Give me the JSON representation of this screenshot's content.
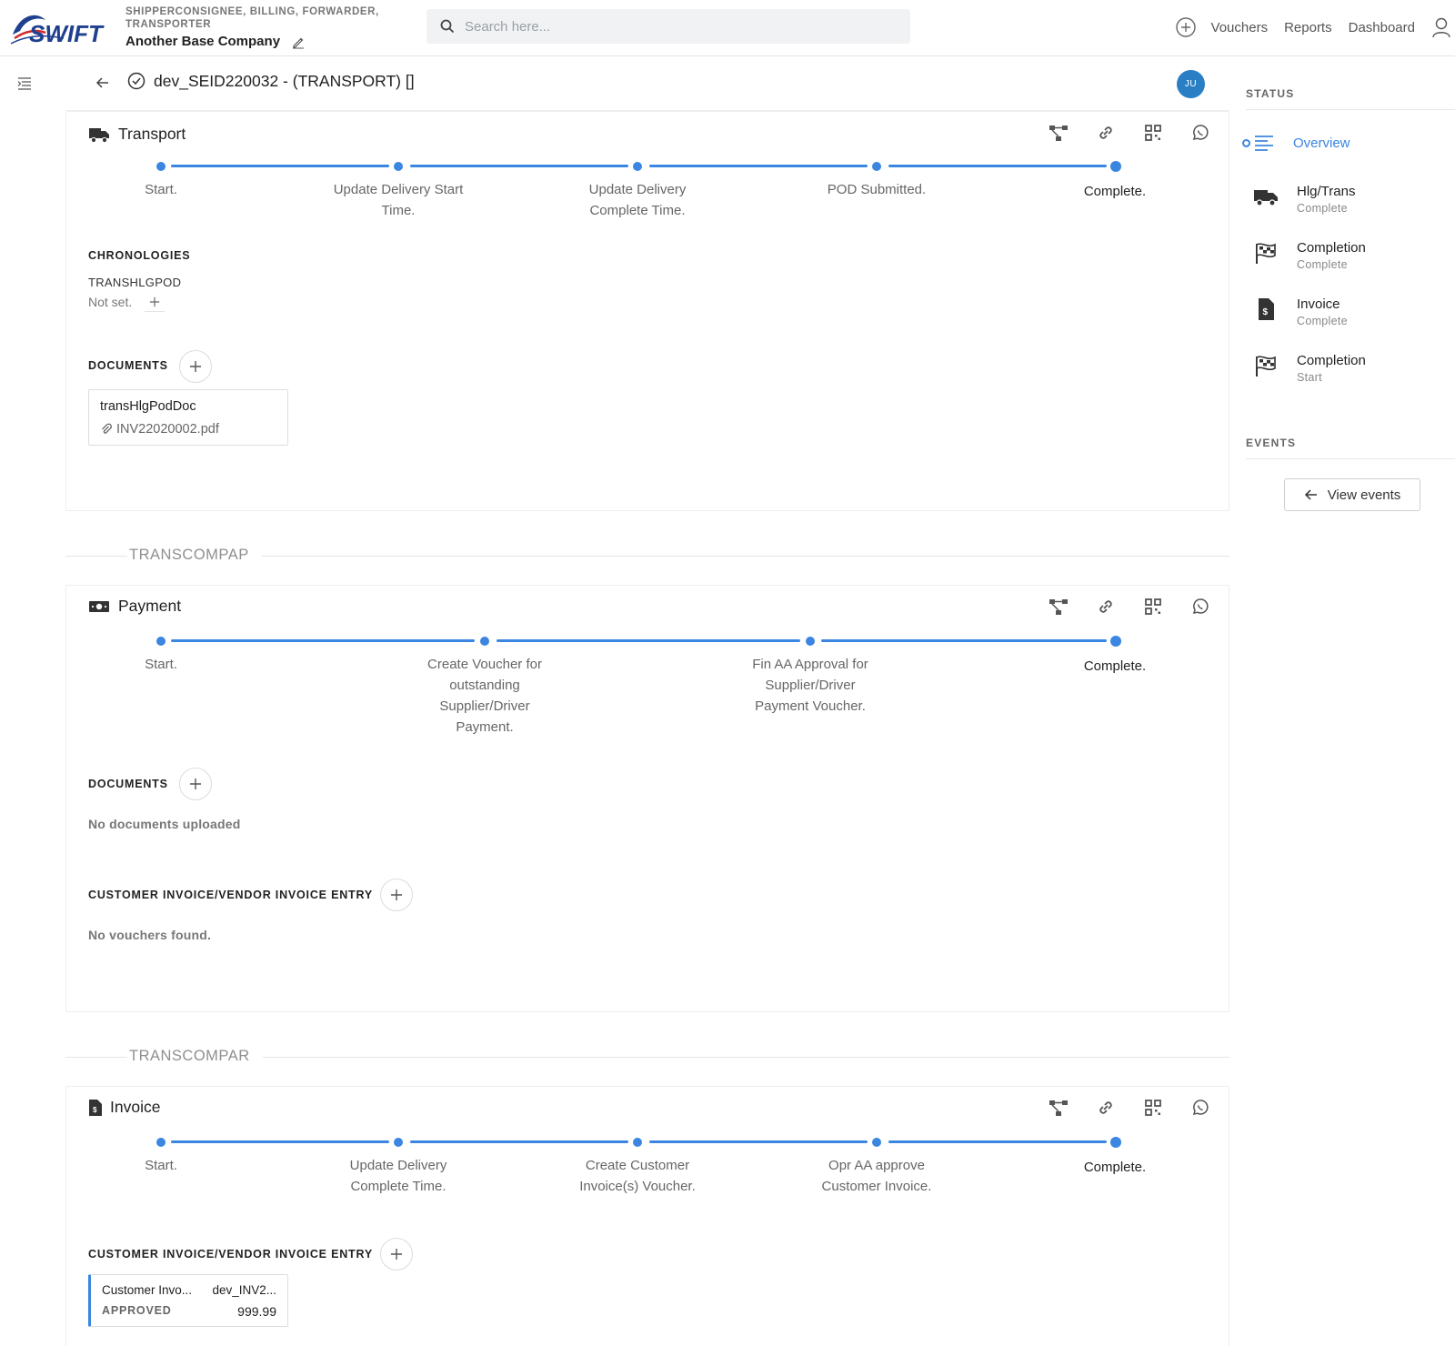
{
  "header": {
    "brand": "SWIFT",
    "company_roles": "SHIPPERCONSIGNEE, BILLING, FORWARDER, TRANSPORTER",
    "company_name": "Another Base Company",
    "search_placeholder": "Search here...",
    "nav": [
      "Vouchers",
      "Reports",
      "Dashboard"
    ]
  },
  "page": {
    "title": "dev_SEID220032 - (TRANSPORT) []",
    "avatar_initials": "JU"
  },
  "transport": {
    "title": "Transport",
    "steps": [
      "Start.",
      "Update Delivery Start Time.",
      "Update Delivery Complete Time.",
      "POD Submitted.",
      "Complete."
    ],
    "chronologies_label": "CHRONOLOGIES",
    "chronology_name": "TRANSHLGPOD",
    "chronology_value": "Not set.",
    "documents_label": "DOCUMENTS",
    "document": {
      "name": "transHlgPodDoc",
      "file": "INV22020002.pdf"
    }
  },
  "group1": {
    "label": "TRANSCOMPAP"
  },
  "payment": {
    "title": "Payment",
    "steps": [
      "Start.",
      "Create Voucher for outstanding Supplier/Driver Payment.",
      "Fin AA Approval for Supplier/Driver Payment Voucher.",
      "Complete."
    ],
    "documents_label": "DOCUMENTS",
    "no_documents": "No documents uploaded",
    "voucher_label": "CUSTOMER INVOICE/VENDOR INVOICE ENTRY",
    "no_vouchers": "No vouchers found."
  },
  "group2": {
    "label": "TRANSCOMPAR"
  },
  "invoice": {
    "title": "Invoice",
    "steps": [
      "Start.",
      "Update Delivery Complete Time.",
      "Create Customer Invoice(s) Voucher.",
      "Opr AA approve Customer Invoice.",
      "Complete."
    ],
    "voucher_label": "CUSTOMER INVOICE/VENDOR INVOICE ENTRY",
    "voucher": {
      "type": "Customer Invo...",
      "ref": "dev_INV2...",
      "status": "APPROVED",
      "amount": "999.99"
    }
  },
  "sidebar": {
    "status_heading": "STATUS",
    "overview": "Overview",
    "items": [
      {
        "title": "Hlg/Trans",
        "sub": "Complete",
        "icon": "truck-icon"
      },
      {
        "title": "Completion",
        "sub": "Complete",
        "icon": "checkered-flag-icon"
      },
      {
        "title": "Invoice",
        "sub": "Complete",
        "icon": "invoice-icon"
      },
      {
        "title": "Completion",
        "sub": "Start",
        "icon": "checkered-flag-icon"
      }
    ],
    "events_heading": "EVENTS",
    "view_events": "View events"
  },
  "colors": {
    "accent": "#3a86e0",
    "avatar": "#2a7fc4"
  }
}
